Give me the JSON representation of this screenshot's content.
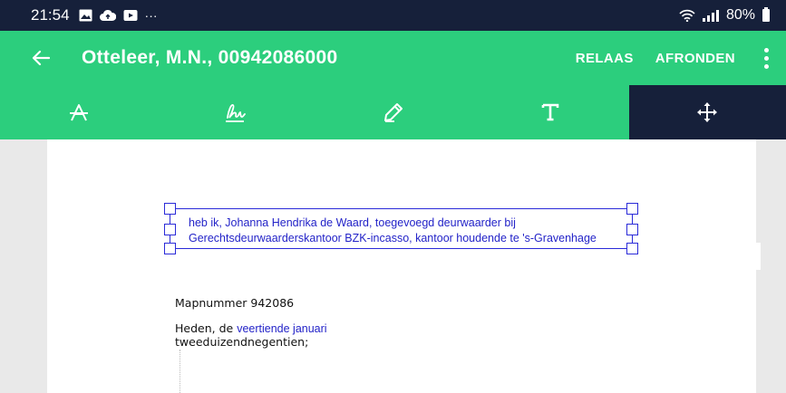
{
  "status_bar": {
    "time": "21:54",
    "more": "···",
    "battery": "80%",
    "icons": [
      "image-icon",
      "cloud-upload-icon",
      "video-icon",
      "wifi-icon",
      "signal-icon",
      "battery-icon"
    ]
  },
  "app_bar": {
    "title": "Otteleer, M.N., 00942086000",
    "actions": {
      "relaas": "RELAAS",
      "afronden": "AFRONDEN"
    },
    "icons": [
      "back-arrow-icon",
      "overflow-menu-icon"
    ]
  },
  "toolbar": {
    "tools": [
      "strikethrough-tool-icon",
      "signature-tool-icon",
      "pen-tool-icon",
      "text-tool-icon",
      "move-tool-icon"
    ],
    "active_tool": "move"
  },
  "document": {
    "textbox": {
      "line1": "heb ik, Johanna Hendrika de Waard, toegevoegd deurwaarder bij",
      "line2": "Gerechtsdeurwaarderskantoor BZK-incasso, kantoor houdende te 's-Gravenhage"
    },
    "mapnummer": "Mapnummer 942086",
    "heden_prefix": "Heden, de",
    "heden_date": "veertiende januari",
    "year": "tweeduizendnegentien;"
  },
  "colors": {
    "status_bar_bg": "#16203a",
    "accent_green": "#2cce7d",
    "active_tool_bg": "#16203a",
    "annotation_blue": "#2323c8"
  }
}
